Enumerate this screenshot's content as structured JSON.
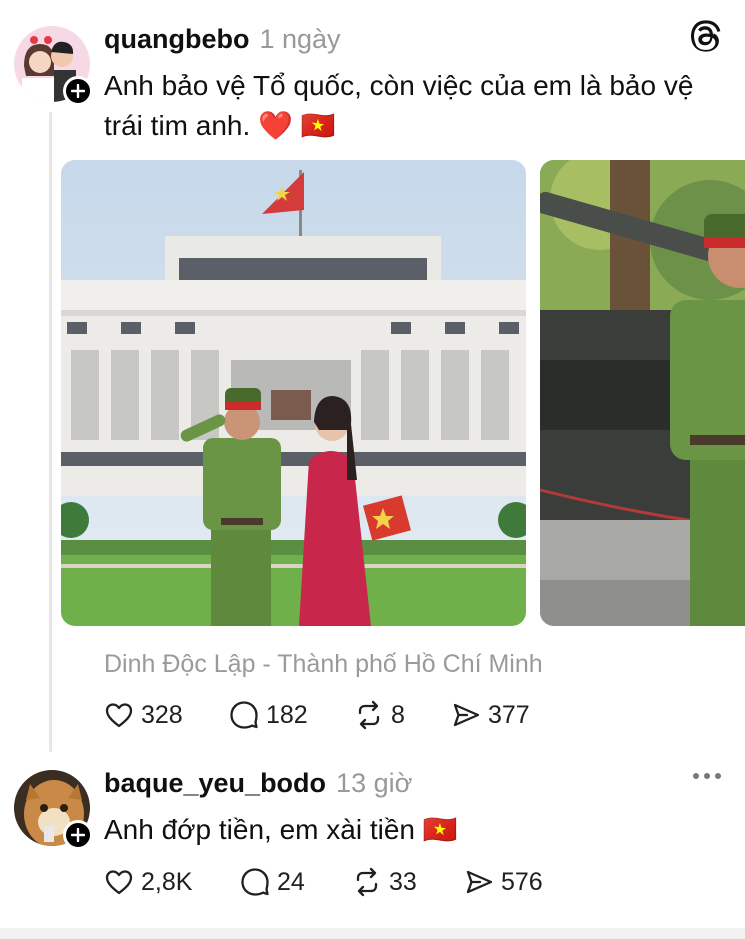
{
  "post": {
    "username": "quangbebo",
    "time": "1 ngày",
    "text_line1": "Anh bảo vệ Tổ quốc, còn việc của em là bảo vệ",
    "text_line2": "trái tim anh. ❤️ 🇻🇳",
    "location": "Dinh Độc Lập - Thành phố Hồ Chí Minh",
    "likes": "328",
    "comments": "182",
    "reposts": "8",
    "shares": "377"
  },
  "reply": {
    "username": "baque_yeu_bodo",
    "time": "13 giờ",
    "text": "Anh đớp tiền, em xài tiền 🇻🇳",
    "likes": "2,8K",
    "comments": "24",
    "reposts": "33",
    "shares": "576"
  },
  "icons": {
    "logo": "threads-logo-icon",
    "follow": "plus-icon",
    "like": "heart-icon",
    "comment": "comment-bubble-icon",
    "repost": "repost-icon",
    "share": "send-icon",
    "more": "more-dots-icon"
  },
  "colors": {
    "text": "#101010",
    "muted": "#999999",
    "thread_line": "#e6e6e6"
  }
}
